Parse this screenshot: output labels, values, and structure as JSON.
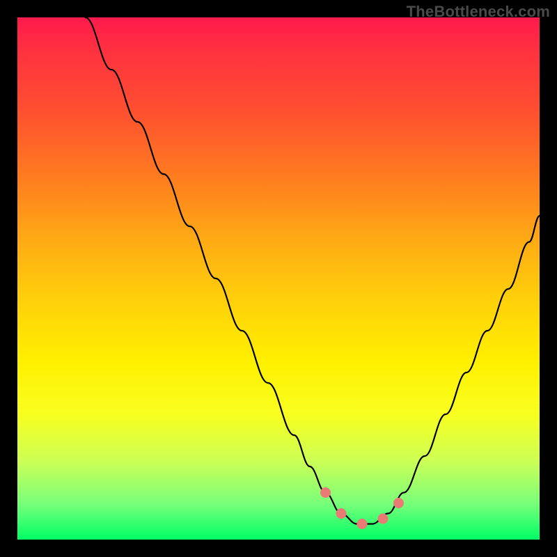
{
  "watermark": "TheBottleneck.com",
  "colors": {
    "frame": "#000000",
    "curve": "#000000",
    "marker": "#e97a74",
    "gradient_top": "#ff1a4d",
    "gradient_mid": "#fff000",
    "gradient_bottom": "#00ff66"
  },
  "chart_data": {
    "type": "line",
    "title": "",
    "xlabel": "",
    "ylabel": "",
    "xlim": [
      0,
      100
    ],
    "ylim": [
      0,
      100
    ],
    "grid": false,
    "legend": false,
    "series": [
      {
        "name": "curve",
        "x": [
          13,
          18,
          23,
          28,
          33,
          38,
          43,
          48,
          53,
          56,
          59,
          62,
          65,
          68,
          71,
          74,
          78,
          82,
          86,
          90,
          94,
          98,
          100
        ],
        "y": [
          100,
          90,
          80,
          70,
          60,
          50,
          40,
          30,
          20,
          14,
          9,
          5,
          3,
          3,
          5,
          9,
          16,
          24,
          32,
          40,
          48,
          57,
          62
        ]
      }
    ],
    "markers": [
      {
        "name": "red-marker-left",
        "x": 59,
        "y": 9
      },
      {
        "name": "red-marker-mid-left",
        "x": 62,
        "y": 5
      },
      {
        "name": "red-marker-bottom",
        "x": 66,
        "y": 3
      },
      {
        "name": "red-marker-mid-right",
        "x": 70,
        "y": 4
      },
      {
        "name": "red-marker-right",
        "x": 73,
        "y": 7
      }
    ]
  }
}
